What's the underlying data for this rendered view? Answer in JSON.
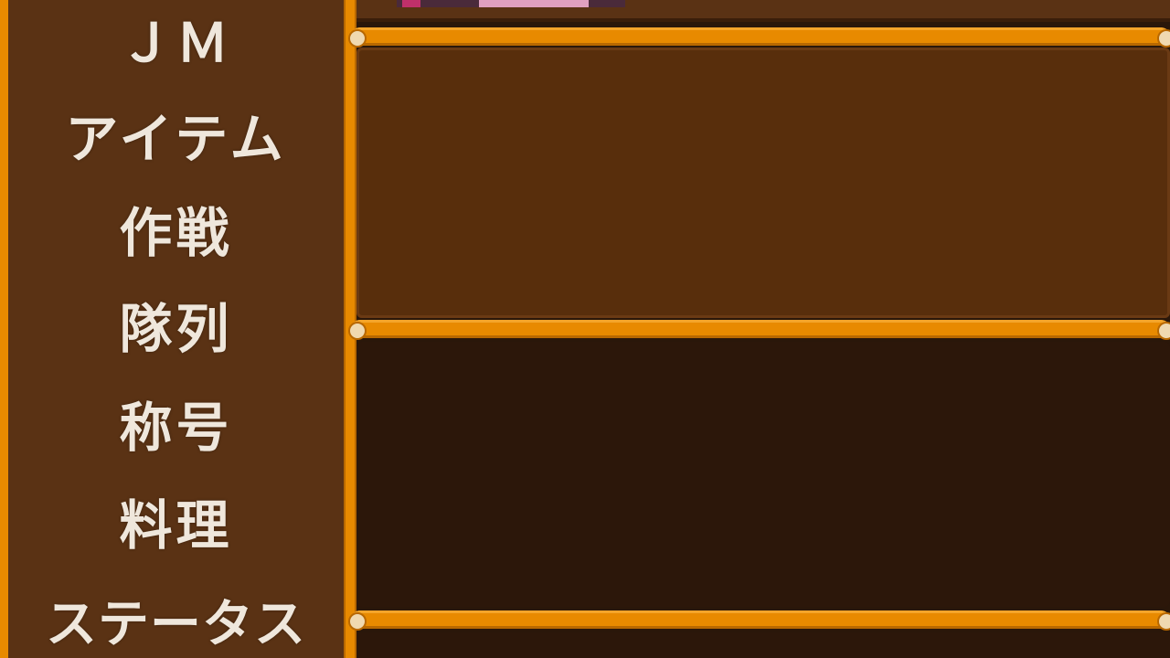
{
  "menu": {
    "items": [
      {
        "label": "ＪＭ"
      },
      {
        "label": "アイテム"
      },
      {
        "label": "作戦"
      },
      {
        "label": "隊列"
      },
      {
        "label": "称号"
      },
      {
        "label": "料理"
      },
      {
        "label": "ステータス"
      }
    ]
  },
  "colors": {
    "frame_orange": "#e88a00",
    "menu_brown": "#5a3214",
    "panel_brown": "#582e0c",
    "panel_dark": "#2c170a",
    "text": "#efe7dc"
  }
}
